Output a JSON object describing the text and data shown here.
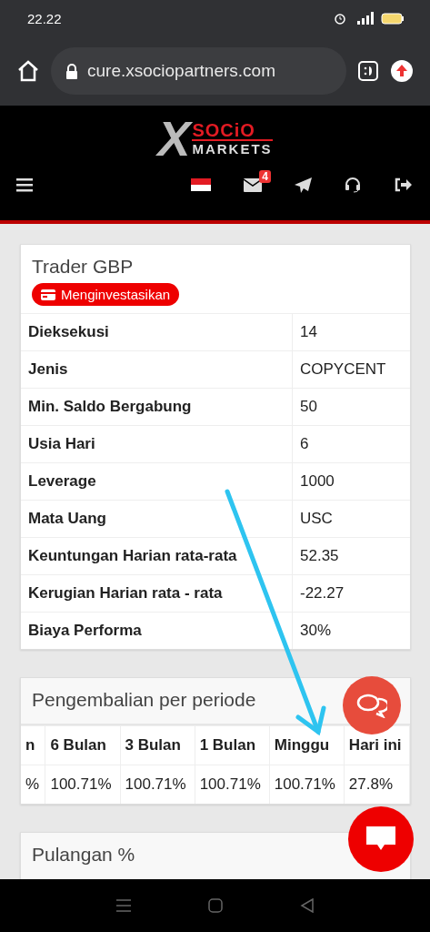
{
  "status_bar": {
    "time": "22.22"
  },
  "browser": {
    "url": "cure.xsociopartners.com"
  },
  "site_header": {
    "logo": {
      "mark": "X",
      "top": "SOCiO",
      "bottom": "MARKETS"
    },
    "mail_badge": "4"
  },
  "trader_card": {
    "title": "Trader GBP",
    "status_badge": "Menginvestasikan",
    "rows": [
      {
        "label": "Dieksekusi",
        "value": "14"
      },
      {
        "label": "Jenis",
        "value": "COPYCENT"
      },
      {
        "label": "Min. Saldo Bergabung",
        "value": "50"
      },
      {
        "label": "Usia Hari",
        "value": "6"
      },
      {
        "label": "Leverage",
        "value": "1000"
      },
      {
        "label": "Mata Uang",
        "value": "USC"
      },
      {
        "label": "Keuntungan Harian rata-rata",
        "value": "52.35"
      },
      {
        "label": "Kerugian Harian rata - rata",
        "value": "-22.27"
      },
      {
        "label": "Biaya Performa",
        "value": "30%"
      }
    ]
  },
  "returns_card": {
    "title": "Pengembalian per periode",
    "columns": [
      "n",
      "6 Bulan",
      "3 Bulan",
      "1 Bulan",
      "Minggu",
      "Hari ini"
    ],
    "values": [
      "%",
      "100.71%",
      "100.71%",
      "100.71%",
      "100.71%",
      "27.8%"
    ]
  },
  "drawdown_card": {
    "title": "Pulangan %"
  }
}
